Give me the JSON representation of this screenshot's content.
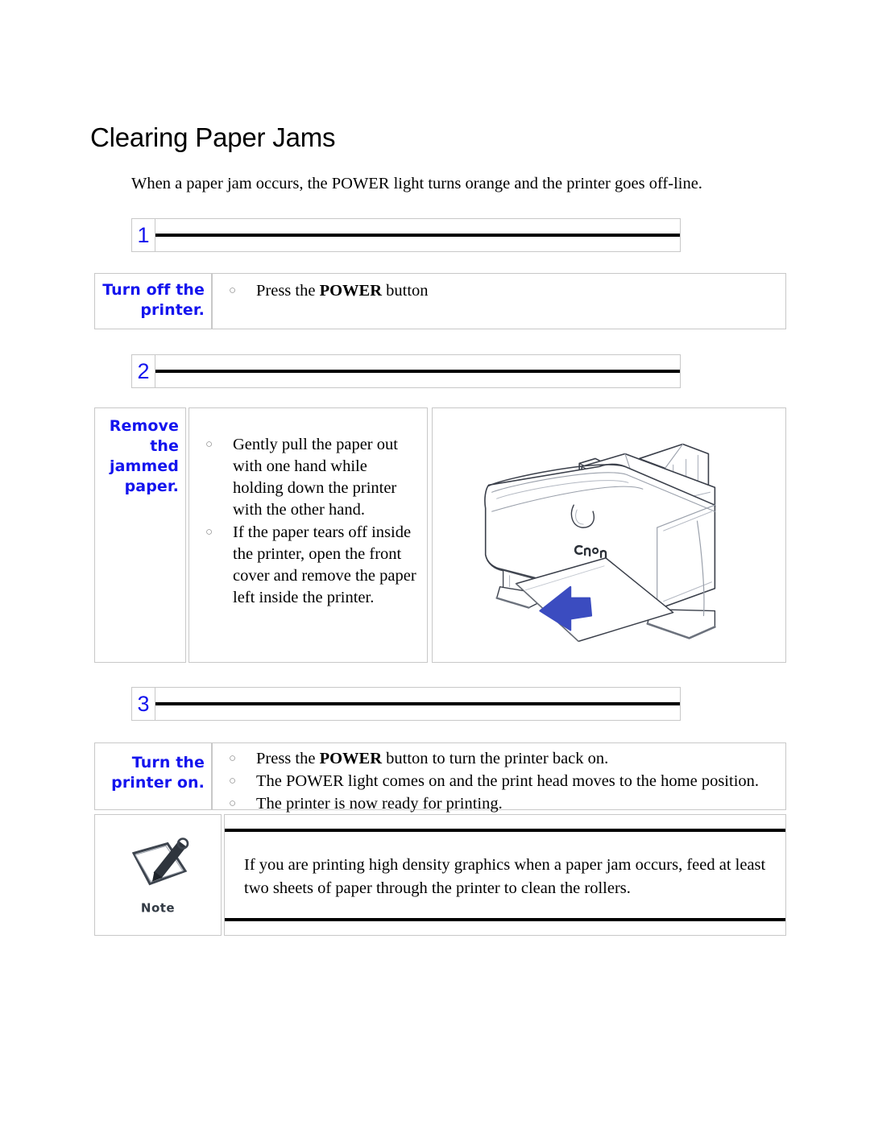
{
  "document": {
    "title": "Clearing Paper Jams",
    "intro": "When a paper jam occurs, the POWER light turns orange and the printer goes off-line."
  },
  "steps": [
    {
      "number": "1",
      "label": "Turn off the printer.",
      "bullets": [
        {
          "before": "Press the ",
          "bold": "POWER",
          "after": " button"
        }
      ]
    },
    {
      "number": "2",
      "label": "Remove the jammed paper.",
      "bullets": [
        {
          "before": "Gently pull the paper out with one hand while holding down the printer with the other hand.",
          "bold": "",
          "after": ""
        },
        {
          "before": "If the paper tears off inside the printer, open the front cover and remove the paper left inside the printer.",
          "bold": "",
          "after": ""
        }
      ],
      "illustration": {
        "name": "canon-printer-paper-jam-illustration",
        "brand_mark": "Canon",
        "arrow_color": "#3B4CC0",
        "arrow_direction": "down-left"
      }
    },
    {
      "number": "3",
      "label": "Turn the printer on.",
      "bullets": [
        {
          "before": "Press the ",
          "bold": "POWER",
          "after": " button to turn the printer back on."
        },
        {
          "before": "The POWER light comes on and the print head moves to the home position.",
          "bold": "",
          "after": ""
        },
        {
          "before": "The printer is now ready for printing.",
          "bold": "",
          "after": ""
        }
      ]
    }
  ],
  "note": {
    "icon_label": "Note",
    "text": "If you are printing high density graphics when a paper jam occurs, feed at least two sheets of paper through the printer to clean the rollers."
  },
  "bullet_glyph": "○",
  "colors": {
    "step_blue": "#1414EE",
    "label_blue": "#1414EE",
    "rule_black": "#000000",
    "cell_border": "#C8C8C8",
    "arrow_blue": "#3B4CC0"
  }
}
